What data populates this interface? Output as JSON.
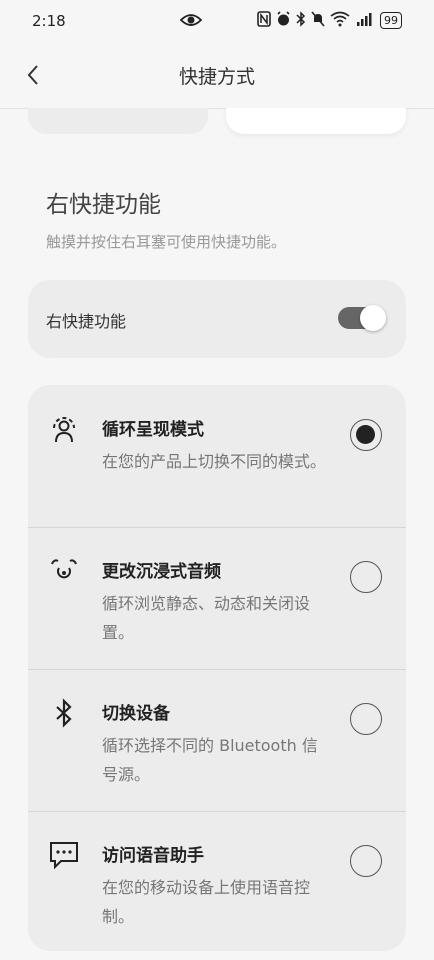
{
  "status_bar": {
    "time": "2:18",
    "battery": "99"
  },
  "header": {
    "title": "快捷方式"
  },
  "section": {
    "title": "右快捷功能",
    "description": "触摸并按住右耳塞可使用快捷功能。"
  },
  "toggle": {
    "label": "右快捷功能",
    "state": "on"
  },
  "options": [
    {
      "title": "循环呈现模式",
      "description": "在您的产品上切换不同的模式。",
      "icon": "ambient-mode-icon",
      "selected": true
    },
    {
      "title": "更改沉浸式音频",
      "description": "循环浏览静态、动态和关闭设置。",
      "icon": "immersive-audio-icon",
      "selected": false
    },
    {
      "title": "切换设备",
      "description": "循环选择不同的 Bluetooth 信号源。",
      "icon": "bluetooth-icon",
      "selected": false
    },
    {
      "title": "访问语音助手",
      "description": "在您的移动设备上使用语音控制。",
      "icon": "voice-assistant-icon",
      "selected": false
    }
  ]
}
